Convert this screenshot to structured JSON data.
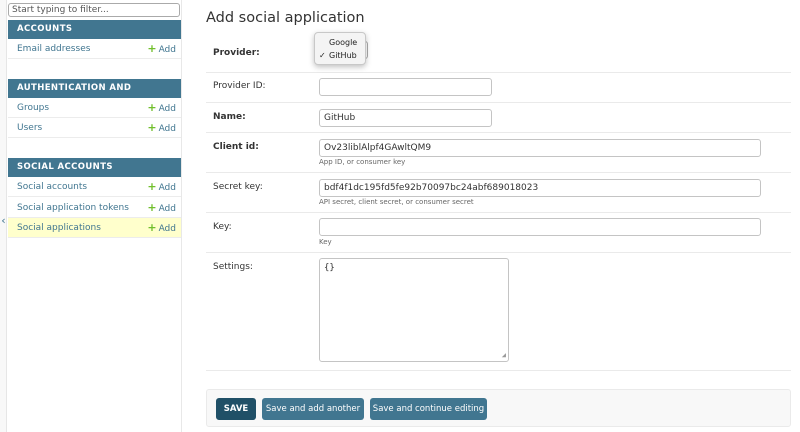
{
  "sidebar": {
    "filter_placeholder": "Start typing to filter...",
    "collapse_glyph": "‹",
    "add_label": "Add",
    "modules": [
      {
        "caption": "ACCOUNTS",
        "items": [
          {
            "label": "Email addresses"
          }
        ]
      },
      {
        "caption": "AUTHENTICATION AND AUTHORIZATION",
        "items": [
          {
            "label": "Groups"
          },
          {
            "label": "Users"
          }
        ]
      },
      {
        "caption": "SOCIAL ACCOUNTS",
        "items": [
          {
            "label": "Social accounts"
          },
          {
            "label": "Social application tokens"
          },
          {
            "label": "Social applications",
            "current": true
          }
        ]
      }
    ]
  },
  "form": {
    "title": "Add social application",
    "provider": {
      "label": "Provider:",
      "options": [
        {
          "label": "Google",
          "selected": false
        },
        {
          "label": "GitHub",
          "selected": true
        }
      ],
      "check_glyph": "✓"
    },
    "provider_id": {
      "label": "Provider ID:",
      "value": ""
    },
    "name": {
      "label": "Name:",
      "value": "GitHub"
    },
    "client_id": {
      "label": "Client id:",
      "value": "Ov23liblAlpf4GAwltQM9",
      "help": "App ID, or consumer key"
    },
    "secret_key": {
      "label": "Secret key:",
      "value": "bdf4f1dc195fd5fe92b70097bc24abf689018023",
      "help": "API secret, client secret, or consumer secret"
    },
    "key": {
      "label": "Key:",
      "value": "",
      "help": "Key"
    },
    "settings": {
      "label": "Settings:",
      "value": "{}"
    }
  },
  "actions": {
    "save": "SAVE",
    "save_add_another": "Save and add another",
    "save_continue": "Save and continue editing"
  },
  "colors": {
    "module_header": "#417690",
    "add_plus": "#70bf2b",
    "current_row": "#ffffcc",
    "save_button": "#205067"
  }
}
